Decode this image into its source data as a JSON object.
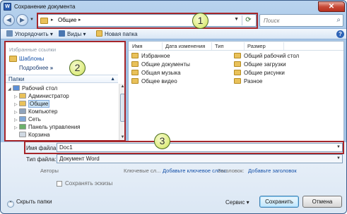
{
  "window": {
    "title": "Сохранение документа",
    "app_icon": "W",
    "close_glyph": "✕"
  },
  "nav": {
    "address_crumb": "Общие",
    "search_placeholder": "Поиск"
  },
  "toolbar": {
    "organize": "Упорядочить",
    "views": "Виды",
    "new_folder": "Новая папка"
  },
  "favorites": {
    "header": "Избранные ссылки",
    "items": [
      "Шаблоны"
    ],
    "more": "Подробнее",
    "more_chevron": "»"
  },
  "folders": {
    "header": "Папки",
    "tree": [
      {
        "label": "Рабочий стол",
        "level": 0,
        "expanded": true,
        "color": "#5b8fd6"
      },
      {
        "label": "Администратор",
        "level": 1,
        "color": "#e9c15a"
      },
      {
        "label": "Общие",
        "level": 1,
        "selected": true,
        "color": "#e9c15a"
      },
      {
        "label": "Компьютер",
        "level": 1,
        "color": "#8fa3bb"
      },
      {
        "label": "Сеть",
        "level": 1,
        "color": "#7ea7d8"
      },
      {
        "label": "Панель управления",
        "level": 1,
        "color": "#6bb06b"
      },
      {
        "label": "Корзина",
        "level": 1,
        "color": "#cfd8e2"
      }
    ]
  },
  "columns": [
    "Имя",
    "Дата изменения",
    "Тип",
    "Размер"
  ],
  "files_left": [
    "Избранное",
    "Общие документы",
    "Общая музыка",
    "Общее видео"
  ],
  "files_right": [
    "Общий рабочий стол",
    "Общие загрузки",
    "Общие рисунки",
    "Разное"
  ],
  "form": {
    "filename_label": "Имя файла:",
    "filename_value": "Doc1",
    "filetype_label": "Тип файла:",
    "filetype_value": "Документ Word",
    "authors_label": "Авторы",
    "authors_link": "",
    "tags_label": "Ключевые сл...",
    "tags_link": "Добавьте ключевое слово",
    "title_label": "Заголовок:",
    "title_link": "Добавьте заголовок",
    "thumbnail_label": "Сохранять эскизы"
  },
  "footer": {
    "hide_folders": "Скрыть папки",
    "service": "Сервис",
    "save": "Сохранить",
    "cancel": "Отмена"
  },
  "callouts": [
    "1",
    "2",
    "3"
  ],
  "colors": {
    "callout_border": "#a6262a",
    "callout_fill": "#e1ee8a",
    "accent": "#3c7fb1"
  }
}
